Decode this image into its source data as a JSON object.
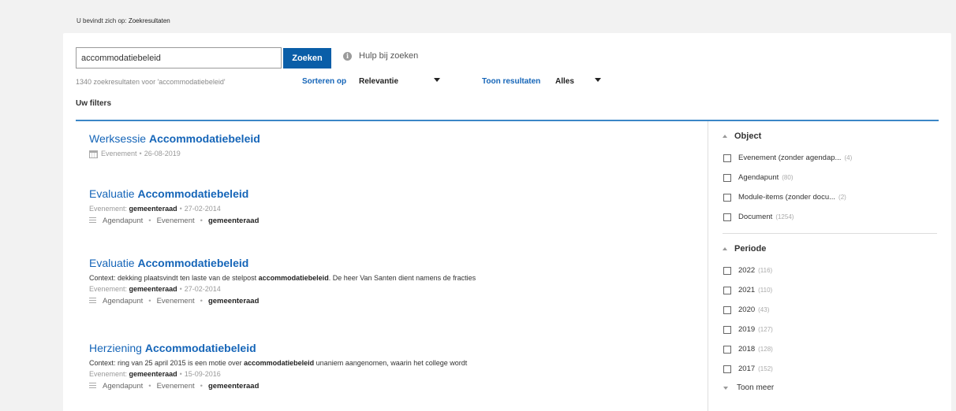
{
  "breadcrumb": {
    "prefix": "U bevindt zich op:",
    "current": "Zoekresultaten"
  },
  "search": {
    "value": "accommodatiebeleid",
    "button": "Zoeken",
    "help": "Hulp bij zoeken",
    "info_icon": "i"
  },
  "results_bar": {
    "count_text": "1340 zoekresultaten voor 'accommodatiebeleid'",
    "sort_label": "Sorteren op",
    "sort_value": "Relevantie",
    "show_label": "Toon resultaten",
    "show_value": "Alles",
    "filters_label": "Uw filters"
  },
  "results": [
    {
      "title_prefix": "Werksessie",
      "title_bold": "Accommodatiebeleid",
      "type": "Evenement",
      "date": "26-08-2019"
    },
    {
      "title_prefix": "Evaluatie",
      "title_bold": "Accommodatiebeleid",
      "event_label": "Evenement:",
      "event_value": "gemeenteraad",
      "date": "27-02-2014",
      "crumbs": [
        "Agendapunt",
        "Evenement",
        "gemeenteraad"
      ]
    },
    {
      "title_prefix": "Evaluatie",
      "title_bold": "Accommodatiebeleid",
      "context_pre": "Context: dekking plaatsvindt ten laste van de stelpost",
      "context_bold": "accommodatiebeleid",
      "context_post": ". De heer Van Santen dient namens de fracties",
      "event_label": "Evenement:",
      "event_value": "gemeenteraad",
      "date": "27-02-2014",
      "crumbs": [
        "Agendapunt",
        "Evenement",
        "gemeenteraad"
      ]
    },
    {
      "title_prefix": "Herziening",
      "title_bold": "Accommodatiebeleid",
      "context_pre": "Context: ring van 25 april 2015 is een motie over",
      "context_bold": "accommodatiebeleid",
      "context_post": " unaniem aangenomen, waarin het college wordt",
      "event_label": "Evenement:",
      "event_value": "gemeenteraad",
      "date": "15-09-2016",
      "crumbs": [
        "Agendapunt",
        "Evenement",
        "gemeenteraad"
      ]
    }
  ],
  "sidebar": {
    "object": {
      "title": "Object",
      "options": [
        {
          "label": "Evenement (zonder agendap...",
          "count": "(4)"
        },
        {
          "label": "Agendapunt",
          "count": "(80)"
        },
        {
          "label": "Module-items (zonder docu...",
          "count": "(2)"
        },
        {
          "label": "Document",
          "count": "(1254)"
        }
      ]
    },
    "periode": {
      "title": "Periode",
      "options": [
        {
          "label": "2022",
          "count": "(116)"
        },
        {
          "label": "2021",
          "count": "(110)"
        },
        {
          "label": "2020",
          "count": "(43)"
        },
        {
          "label": "2019",
          "count": "(127)"
        },
        {
          "label": "2018",
          "count": "(128)"
        },
        {
          "label": "2017",
          "count": "(152)"
        }
      ]
    },
    "more": "Toon meer"
  }
}
